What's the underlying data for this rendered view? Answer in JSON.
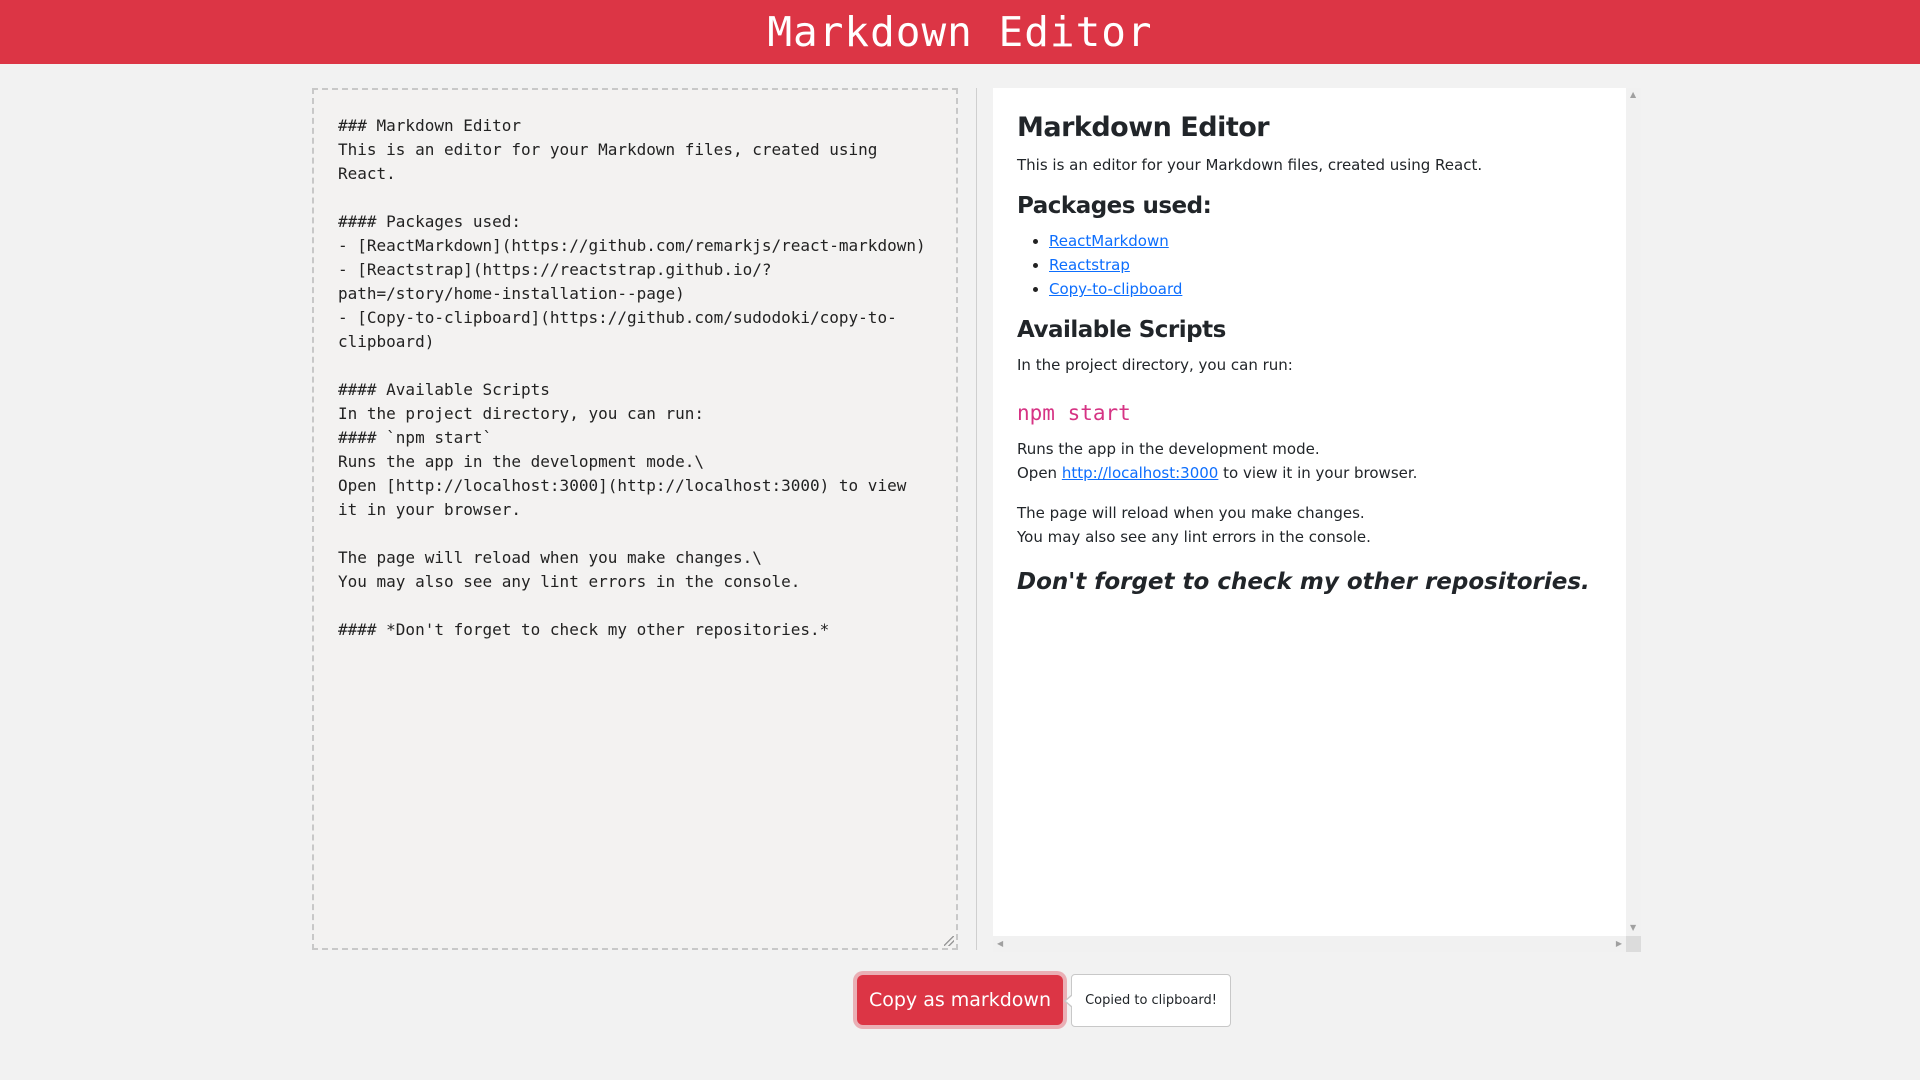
{
  "header": {
    "title": "Markdown Editor"
  },
  "editor": {
    "content": "### Markdown Editor\nThis is an editor for your Markdown files, created using React.\n\n#### Packages used:\n- [ReactMarkdown](https://github.com/remarkjs/react-markdown)\n- [Reactstrap](https://reactstrap.github.io/?path=/story/home-installation--page)\n- [Copy-to-clipboard](https://github.com/sudodoki/copy-to-clipboard)\n\n#### Available Scripts\nIn the project directory, you can run:\n#### `npm start`\nRuns the app in the development mode.\\\nOpen [http://localhost:3000](http://localhost:3000) to view it in your browser.\n\nThe page will reload when you make changes.\\\nYou may also see any lint errors in the console.\n\n#### *Don't forget to check my other repositories.*"
  },
  "preview": {
    "title": "Markdown Editor",
    "intro": "This is an editor for your Markdown files, created using React.",
    "packages_heading": "Packages used:",
    "packages": [
      "ReactMarkdown",
      "Reactstrap",
      "Copy-to-clipboard"
    ],
    "scripts_heading": "Available Scripts",
    "scripts_intro": "In the project directory, you can run:",
    "command": "npm start",
    "runs_line": "Runs the app in the development mode.",
    "open_prefix": "Open ",
    "open_link": "http://localhost:3000",
    "open_suffix": " to view it in your browser.",
    "reload_line": "The page will reload when you make changes.",
    "lint_line": "You may also see any lint errors in the console.",
    "closing": "Don't forget to check my other repositories."
  },
  "actions": {
    "copy_label": "Copy as markdown",
    "tooltip": "Copied to clipboard!"
  },
  "colors": {
    "brand": "#dc3545",
    "link": "#0d6efd",
    "code": "#d63384"
  }
}
